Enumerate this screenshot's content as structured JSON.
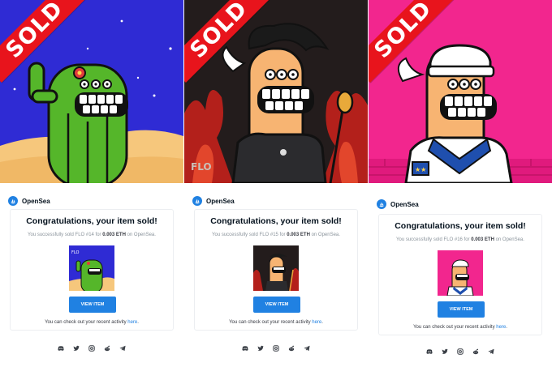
{
  "columns": [
    {
      "sold": "SOLD",
      "art_colors": {
        "bg": "#2f2bd4",
        "ground": "#f6c77c",
        "body": "#55b62a"
      },
      "brand": "OpenSea",
      "title": "Congratulations, your item sold!",
      "sub_pre": "You successfully sold FLO #14 for",
      "price": "0.003 ETH",
      "sub_post": "on OpenSea.",
      "button": "VIEW ITEM",
      "note_pre": "You can check out your recent activity",
      "note_link": "here",
      "note_end": "."
    },
    {
      "sold": "SOLD",
      "art_colors": {
        "bg": "#231c1c",
        "ground": "#b3201b",
        "body": "#f7b472"
      },
      "brand": "OpenSea",
      "title": "Congratulations, your item sold!",
      "sub_pre": "You successfully sold FLO #15 for",
      "price": "0.003 ETH",
      "sub_post": "on OpenSea.",
      "button": "VIEW ITEM",
      "note_pre": "You can check out your recent activity",
      "note_link": "here",
      "note_end": "."
    },
    {
      "sold": "SOLD",
      "art_colors": {
        "bg": "#f2268e",
        "ground": "#ffffff",
        "body": "#f7b472"
      },
      "brand": "OpenSea",
      "title": "Congratulations, your item sold!",
      "sub_pre": "You successfully sold FLO #16 for",
      "price": "0.003 ETH",
      "sub_post": "on OpenSea.",
      "button": "VIEW ITEM",
      "note_pre": "You can check out your recent activity",
      "note_link": "here",
      "note_end": "."
    }
  ],
  "art_signature": "FLO",
  "social_icons": [
    "discord-icon",
    "twitter-icon",
    "instagram-icon",
    "reddit-icon",
    "telegram-icon"
  ],
  "brand_color": "#2081e2"
}
